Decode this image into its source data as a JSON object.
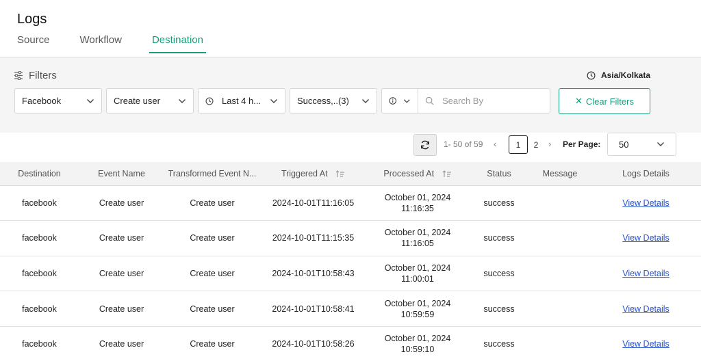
{
  "page": {
    "title": "Logs"
  },
  "tabs": [
    {
      "label": "Source"
    },
    {
      "label": "Workflow"
    },
    {
      "label": "Destination",
      "active": true
    }
  ],
  "filters": {
    "label": "Filters",
    "timezone": "Asia/Kolkata",
    "destination": "Facebook",
    "event": "Create user",
    "time_range": "Last 4 h...",
    "status": "Success,..(3)",
    "search_placeholder": "Search By",
    "clear_label": "Clear Filters"
  },
  "pagination": {
    "range": "1- 50 of 59",
    "pages": [
      "1",
      "2"
    ],
    "current_page": "1",
    "per_page_label": "Per Page:",
    "per_page": "50"
  },
  "table": {
    "columns": [
      "Destination",
      "Event Name",
      "Transformed Event N...",
      "Triggered At",
      "Processed At",
      "Status",
      "Message",
      "Logs Details"
    ],
    "rows": [
      {
        "destination": "facebook",
        "event": "Create user",
        "transformed": "Create user",
        "triggered": "2024-10-01T11:16:05",
        "processed_date": "October 01, 2024",
        "processed_time": "11:16:35",
        "status": "success",
        "message": "",
        "details": "View Details"
      },
      {
        "destination": "facebook",
        "event": "Create user",
        "transformed": "Create user",
        "triggered": "2024-10-01T11:15:35",
        "processed_date": "October 01, 2024",
        "processed_time": "11:16:05",
        "status": "success",
        "message": "",
        "details": "View Details"
      },
      {
        "destination": "facebook",
        "event": "Create user",
        "transformed": "Create user",
        "triggered": "2024-10-01T10:58:43",
        "processed_date": "October 01, 2024",
        "processed_time": "11:00:01",
        "status": "success",
        "message": "",
        "details": "View Details"
      },
      {
        "destination": "facebook",
        "event": "Create user",
        "transformed": "Create user",
        "triggered": "2024-10-01T10:58:41",
        "processed_date": "October 01, 2024",
        "processed_time": "10:59:59",
        "status": "success",
        "message": "",
        "details": "View Details"
      },
      {
        "destination": "facebook",
        "event": "Create user",
        "transformed": "Create user",
        "triggered": "2024-10-01T10:58:26",
        "processed_date": "October 01, 2024",
        "processed_time": "10:59:10",
        "status": "success",
        "message": "",
        "details": "View Details"
      }
    ]
  },
  "colors": {
    "accent": "#1a9b7a",
    "link": "#2b55c8"
  }
}
